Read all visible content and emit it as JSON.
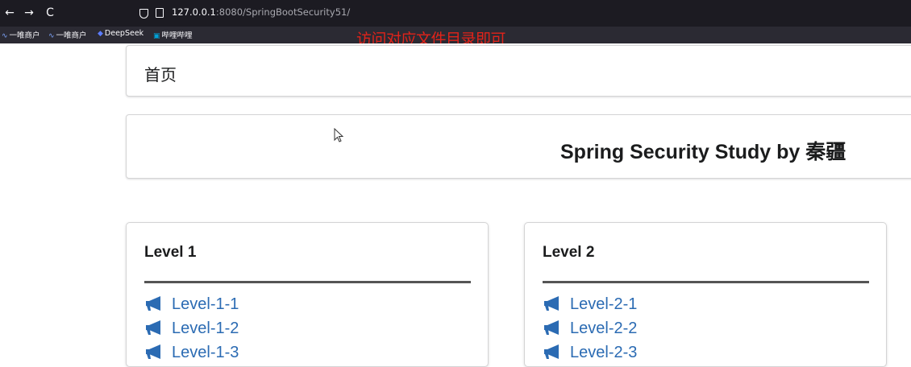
{
  "browser": {
    "back_glyph": "←",
    "forward_glyph": "→",
    "reload_glyph": "C",
    "url_host": "127.0.0.1",
    "url_rest": ":8080/SpringBootSecurity51/",
    "bookmarks": [
      "一唯商户",
      "一唯商户",
      "DeepSeek",
      "哔哩哔哩"
    ]
  },
  "overlay_caption": "访问对应文件目录即可",
  "page": {
    "home_link": "首页",
    "title": "Spring Security Study by 秦疆",
    "levels": [
      {
        "header": "Level 1",
        "items": [
          "Level-1-1",
          "Level-1-2",
          "Level-1-3"
        ]
      },
      {
        "header": "Level 2",
        "items": [
          "Level-2-1",
          "Level-2-2",
          "Level-2-3"
        ]
      }
    ]
  },
  "colors": {
    "toolbar_bg": "#1c1b22",
    "bookmarks_bg": "#2b2a33",
    "link": "#2b6bb3",
    "overlay": "#e2231a"
  },
  "icons": {
    "nav": [
      "back-icon",
      "forward-icon",
      "reload-icon"
    ],
    "url": [
      "shield-icon",
      "page-icon"
    ],
    "level_item": "bullhorn-icon"
  }
}
